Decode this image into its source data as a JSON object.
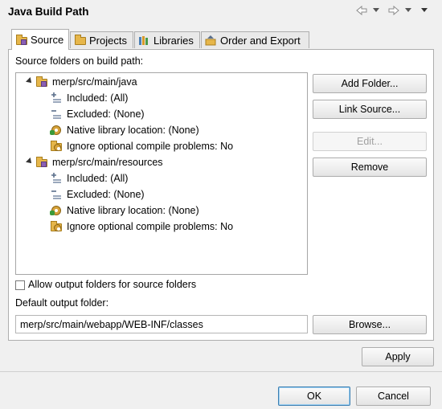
{
  "dialog": {
    "title": "Java Build Path"
  },
  "nav": {
    "back_icon": "back-arrow-icon",
    "forward_icon": "forward-arrow-icon",
    "menu_icon": "dropdown-icon"
  },
  "tabs": [
    {
      "label": "Source",
      "icon": "source-folder-icon",
      "active": true
    },
    {
      "label": "Projects",
      "icon": "project-folder-icon",
      "active": false
    },
    {
      "label": "Libraries",
      "icon": "library-icon",
      "active": false
    },
    {
      "label": "Order and Export",
      "icon": "order-export-icon",
      "active": false
    }
  ],
  "source": {
    "heading": "Source folders on build path:",
    "folders": [
      {
        "name": "merp/src/main/java",
        "children": [
          "Included: (All)",
          "Excluded: (None)",
          "Native library location: (None)",
          "Ignore optional compile problems: No"
        ]
      },
      {
        "name": "merp/src/main/resources",
        "children": [
          "Included: (All)",
          "Excluded: (None)",
          "Native library location: (None)",
          "Ignore optional compile problems: No"
        ]
      }
    ],
    "buttons": {
      "add_folder": "Add Folder...",
      "link_source": "Link Source...",
      "edit": "Edit...",
      "remove": "Remove"
    },
    "allow_output_label": "Allow output folders for source folders",
    "allow_output_checked": false,
    "default_output_label": "Default output folder:",
    "default_output_value": "merp/src/main/webapp/WEB-INF/classes",
    "browse": "Browse..."
  },
  "footer": {
    "apply": "Apply",
    "ok": "OK",
    "cancel": "Cancel"
  }
}
